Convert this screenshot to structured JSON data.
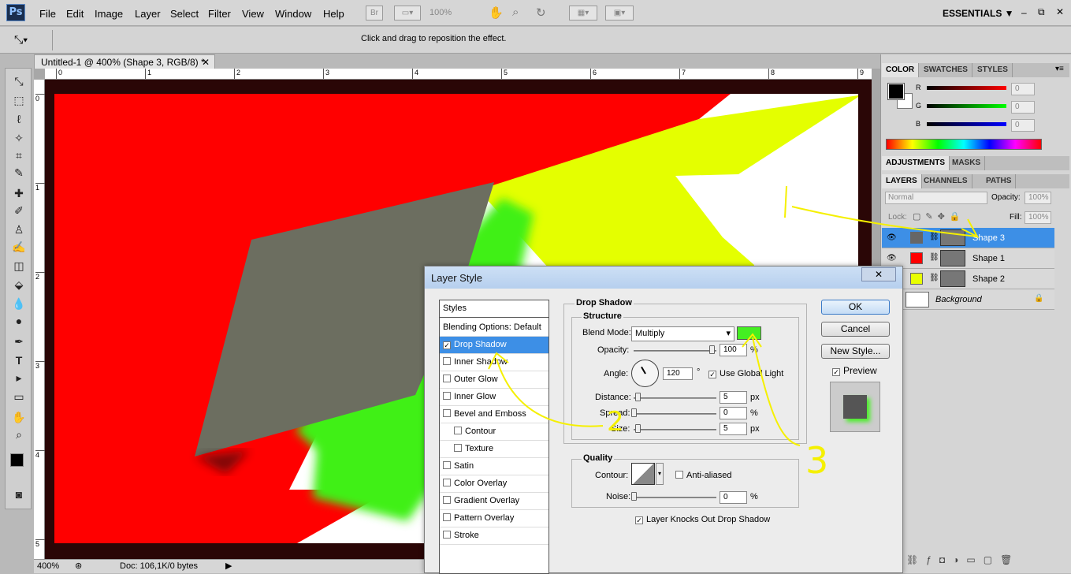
{
  "menubar": {
    "logo": "Ps",
    "items": [
      "File",
      "Edit",
      "Image",
      "Layer",
      "Select",
      "Filter",
      "View",
      "Window",
      "Help"
    ],
    "zoom": "100%",
    "bridge": "Br",
    "workspace": "ESSENTIALS ▼"
  },
  "options": {
    "message": "Click and drag to reposition the effect."
  },
  "document": {
    "tab_title": "Untitled-1 @ 400% (Shape 3, RGB/8) *",
    "ruler_top": [
      "0",
      "1",
      "2",
      "3",
      "4",
      "5",
      "6",
      "7",
      "8",
      "9"
    ],
    "ruler_left": [
      "0",
      "1",
      "2",
      "3",
      "4",
      "5"
    ],
    "status_zoom": "400%",
    "status_doc": "Doc: 106,1K/0 bytes"
  },
  "color_panel": {
    "tabs": [
      "COLOR",
      "SWATCHES",
      "STYLES"
    ],
    "channels": [
      {
        "label": "R",
        "value": "0"
      },
      {
        "label": "G",
        "value": "0"
      },
      {
        "label": "B",
        "value": "0"
      }
    ]
  },
  "adjustments_panel": {
    "tabs": [
      "ADJUSTMENTS",
      "MASKS"
    ]
  },
  "layers_panel": {
    "tabs": [
      "LAYERS",
      "CHANNELS",
      "PATHS"
    ],
    "blend_mode": "Normal",
    "opacity_label": "Opacity:",
    "opacity": "100%",
    "lock_label": "Lock:",
    "fill_label": "Fill:",
    "fill": "100%",
    "layers": [
      {
        "name": "Shape 3",
        "color": "#666666",
        "selected": true
      },
      {
        "name": "Shape 1",
        "color": "#ff0000",
        "selected": false
      },
      {
        "name": "Shape 2",
        "color": "#e8ff00",
        "selected": false
      },
      {
        "name": "Background",
        "color": "#ffffff",
        "selected": false
      }
    ]
  },
  "dialog": {
    "title": "Layer Style",
    "close": "✕",
    "styles": [
      {
        "label": "Styles",
        "checkbox": false,
        "header": true
      },
      {
        "label": "Blending Options: Default",
        "checkbox": false,
        "header": true
      },
      {
        "label": "Drop Shadow",
        "checked": true
      },
      {
        "label": "Inner Shadow"
      },
      {
        "label": "Outer Glow"
      },
      {
        "label": "Inner Glow"
      },
      {
        "label": "Bevel and Emboss"
      },
      {
        "label": "Contour",
        "indent": true
      },
      {
        "label": "Texture",
        "indent": true
      },
      {
        "label": "Satin"
      },
      {
        "label": "Color Overlay"
      },
      {
        "label": "Gradient Overlay"
      },
      {
        "label": "Pattern Overlay"
      },
      {
        "label": "Stroke"
      }
    ],
    "section_title": "Drop Shadow",
    "structure_title": "Structure",
    "blend_label": "Blend Mode:",
    "blend_value": "Multiply",
    "shadow_color": "#44ee22",
    "opacity_label": "Opacity:",
    "opacity_value": "100",
    "angle_label": "Angle:",
    "angle_value": "120",
    "degree": "°",
    "global_light": "Use Global Light",
    "distance_label": "Distance:",
    "distance_value": "5",
    "spread_label": "Spread:",
    "spread_value": "0",
    "size_label": "Size:",
    "size_value": "5",
    "px": "px",
    "pct": "%",
    "quality_title": "Quality",
    "contour_label": "Contour:",
    "anti_aliased": "Anti-aliased",
    "noise_label": "Noise:",
    "noise_value": "0",
    "knockout": "Layer Knocks Out Drop Shadow",
    "ok": "OK",
    "cancel": "Cancel",
    "new_style": "New Style...",
    "preview": "Preview"
  },
  "annotations": [
    "1",
    "2",
    "3"
  ]
}
